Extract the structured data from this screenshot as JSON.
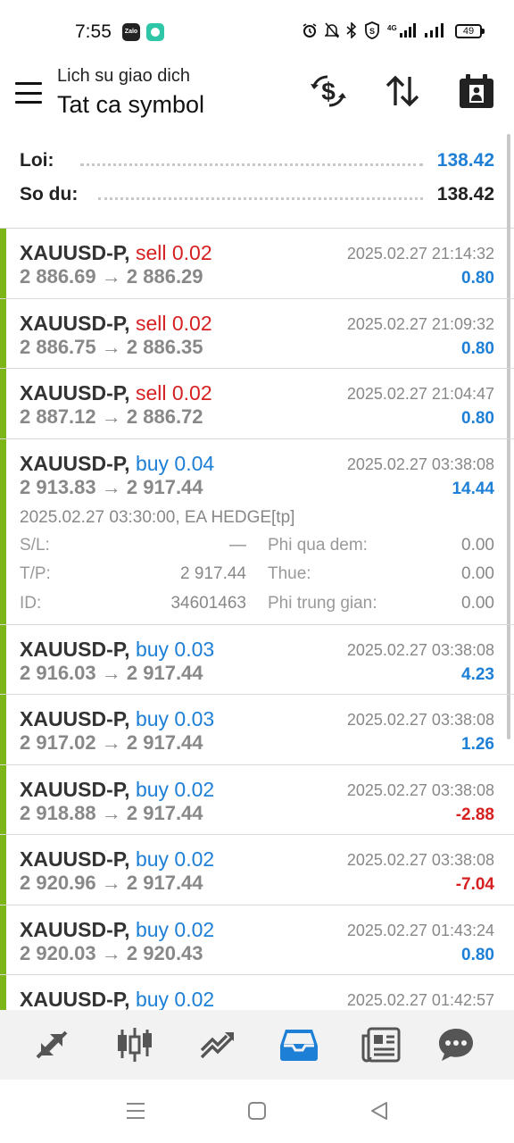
{
  "status_bar": {
    "time": "7:55",
    "apps": [
      "zalo-icon",
      "messenger-icon"
    ],
    "zalo_label": "Zalo",
    "icons": [
      "alarm-icon",
      "mute-icon",
      "bluetooth-icon",
      "vpn-icon",
      "signal-4g-icon",
      "signal-icon"
    ],
    "battery": "49"
  },
  "header": {
    "subtitle": "Lich su giao dich",
    "title": "Tat ca symbol"
  },
  "summary": {
    "profit_label": "Loi:",
    "profit_value": "138.42",
    "balance_label": "So du:",
    "balance_value": "138.42"
  },
  "trades": [
    {
      "symbol": "XAUUSD-P,",
      "side": "sell",
      "volume": "0.02",
      "open": "2 886.69",
      "close": "2 886.29",
      "time": "2025.02.27 21:14:32",
      "profit": "0.80"
    },
    {
      "symbol": "XAUUSD-P,",
      "side": "sell",
      "volume": "0.02",
      "open": "2 886.75",
      "close": "2 886.35",
      "time": "2025.02.27 21:09:32",
      "profit": "0.80"
    },
    {
      "symbol": "XAUUSD-P,",
      "side": "sell",
      "volume": "0.02",
      "open": "2 887.12",
      "close": "2 886.72",
      "time": "2025.02.27 21:04:47",
      "profit": "0.80"
    },
    {
      "symbol": "XAUUSD-P,",
      "side": "buy",
      "volume": "0.04",
      "open": "2 913.83",
      "close": "2 917.44",
      "time": "2025.02.27 03:38:08",
      "profit": "14.44",
      "details": {
        "open_line": "2025.02.27 03:30:00, EA HEDGE[tp]",
        "sl_label": "S/L:",
        "sl_value": "—",
        "tp_label": "T/P:",
        "tp_value": "2 917.44",
        "id_label": "ID:",
        "id_value": "34601463",
        "swap_label": "Phi qua dem:",
        "swap_value": "0.00",
        "tax_label": "Thue:",
        "tax_value": "0.00",
        "fee_label": "Phi trung gian:",
        "fee_value": "0.00"
      }
    },
    {
      "symbol": "XAUUSD-P,",
      "side": "buy",
      "volume": "0.03",
      "open": "2 916.03",
      "close": "2 917.44",
      "time": "2025.02.27 03:38:08",
      "profit": "4.23"
    },
    {
      "symbol": "XAUUSD-P,",
      "side": "buy",
      "volume": "0.03",
      "open": "2 917.02",
      "close": "2 917.44",
      "time": "2025.02.27 03:38:08",
      "profit": "1.26"
    },
    {
      "symbol": "XAUUSD-P,",
      "side": "buy",
      "volume": "0.02",
      "open": "2 918.88",
      "close": "2 917.44",
      "time": "2025.02.27 03:38:08",
      "profit": "-2.88"
    },
    {
      "symbol": "XAUUSD-P,",
      "side": "buy",
      "volume": "0.02",
      "open": "2 920.96",
      "close": "2 917.44",
      "time": "2025.02.27 03:38:08",
      "profit": "-7.04"
    },
    {
      "symbol": "XAUUSD-P,",
      "side": "buy",
      "volume": "0.02",
      "open": "2 920.03",
      "close": "2 920.43",
      "time": "2025.02.27 01:43:24",
      "profit": "0.80"
    },
    {
      "symbol": "XAUUSD-P,",
      "side": "buy",
      "volume": "0.02",
      "open": "",
      "close": "",
      "time": "2025.02.27 01:42:57",
      "profit": ""
    }
  ],
  "arrow": "→",
  "tabs": [
    "quotes-icon",
    "chart-icon",
    "trade-icon",
    "history-icon",
    "news-icon",
    "chat-icon"
  ],
  "active_tab": "history-icon",
  "colors": {
    "accent": "#1e7fd6",
    "sell": "#d62020",
    "buy": "#1e7fd6",
    "trade_bar": "#7cb518",
    "active_tab": "#1e7fd6",
    "inactive_tab": "#555555"
  },
  "nav": [
    "menu-nav-icon",
    "home-nav-icon",
    "back-nav-icon"
  ]
}
